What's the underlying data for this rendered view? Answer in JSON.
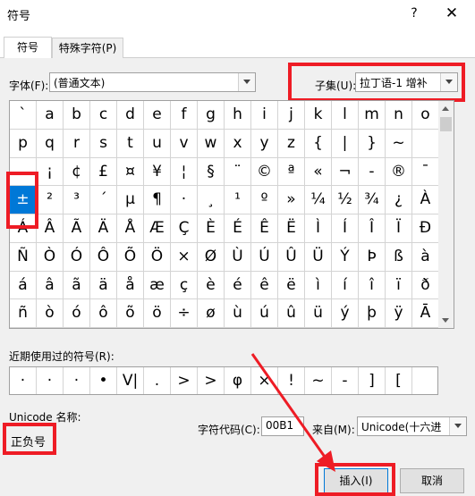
{
  "window": {
    "title": "符号",
    "help": "?",
    "close": "✕"
  },
  "tabs": [
    {
      "label": "符号"
    },
    {
      "label": "特殊字符(P)"
    }
  ],
  "font": {
    "label": "字体(F):",
    "value": "(普通文本)"
  },
  "subset": {
    "label": "子集(U):",
    "value": "拉丁语-1 增补"
  },
  "grid": {
    "rows": [
      [
        "`",
        "a",
        "b",
        "c",
        "d",
        "e",
        "f",
        "g",
        "h",
        "i",
        "j",
        "k",
        "l",
        "m",
        "n",
        "o"
      ],
      [
        "p",
        "q",
        "r",
        "s",
        "t",
        "u",
        "v",
        "w",
        "x",
        "y",
        "z",
        "{",
        "|",
        "}",
        "~",
        ""
      ],
      [
        "",
        "¡",
        "¢",
        "£",
        "¤",
        "¥",
        "¦",
        "§",
        "¨",
        "©",
        "ª",
        "«",
        "¬",
        "-",
        "®",
        "¯"
      ],
      [
        "°",
        "±",
        "²",
        "³",
        "´",
        "µ",
        "¶",
        "·",
        "¸",
        "¹",
        "º",
        "»",
        "¼",
        "½",
        "¾",
        "¿"
      ],
      [
        "À",
        "Á",
        "Â",
        "Ã",
        "Ä",
        "Å",
        "Æ",
        "Ç",
        "È",
        "É",
        "Ê",
        "Ë",
        "Ì",
        "Í",
        "Î",
        "Ï"
      ],
      [
        "Ð",
        "Ñ",
        "Ò",
        "Ó",
        "Ô",
        "Õ",
        "Ö",
        "×",
        "Ø",
        "Ù",
        "Ú",
        "Û",
        "Ü",
        "Ý",
        "Þ",
        "ß"
      ],
      [
        "à",
        "á",
        "â",
        "ã",
        "ä",
        "å",
        "æ",
        "ç",
        "è",
        "é",
        "ê",
        "ë",
        "ì",
        "í",
        "î",
        "ï"
      ],
      [
        "ð",
        "ñ",
        "ò",
        "ó",
        "ô",
        "õ",
        "ö",
        "÷",
        "ø",
        "ù",
        "ú",
        "û",
        "ü",
        "ý",
        "þ",
        "ÿ"
      ]
    ],
    "display": [
      [
        "`",
        "a",
        "b",
        "c",
        "d",
        "e",
        "f",
        "g",
        "h",
        "i",
        "j",
        "k",
        "l",
        "m",
        "n",
        "o"
      ],
      [
        "p",
        "q",
        "r",
        "s",
        "t",
        "u",
        "v",
        "w",
        "x",
        "y",
        "z",
        "{",
        "|",
        "}",
        "~",
        ""
      ],
      [
        "",
        "¡",
        "¢",
        "£",
        "¤",
        "¥",
        "¦",
        "§",
        "¨",
        "©",
        "ª",
        "«",
        "¬",
        "-",
        "®",
        "¯"
      ],
      [
        "±",
        "²",
        "³",
        "´",
        "µ",
        "¶",
        "·",
        "¸",
        "¹",
        "º",
        "»",
        "¼",
        "½",
        "¾",
        "¿",
        "À"
      ],
      [
        "Á",
        "Â",
        "Ã",
        "Ä",
        "Å",
        "Æ",
        "Ç",
        "È",
        "É",
        "Ê",
        "Ë",
        "Ì",
        "Í",
        "Î",
        "Ï",
        "Ð"
      ],
      [
        "Ñ",
        "Ò",
        "Ó",
        "Ô",
        "Õ",
        "Ö",
        "×",
        "Ø",
        "Ù",
        "Ú",
        "Û",
        "Ü",
        "Ý",
        "Þ",
        "ß",
        "à"
      ],
      [
        "á",
        "â",
        "ã",
        "ä",
        "å",
        "æ",
        "ç",
        "è",
        "é",
        "ê",
        "ë",
        "ì",
        "í",
        "î",
        "ï",
        "ð"
      ],
      [
        "ñ",
        "ò",
        "ó",
        "ô",
        "õ",
        "ö",
        "÷",
        "ø",
        "ù",
        "ú",
        "û",
        "ü",
        "ý",
        "þ",
        "ÿ",
        "Ā"
      ]
    ],
    "selected": "±"
  },
  "recent": {
    "label": "近期使用过的符号(R):",
    "symbols": [
      "·",
      "·",
      "·",
      "•",
      "V|",
      ".",
      ">",
      ">",
      "φ",
      "×",
      "!",
      "~",
      "-",
      "]",
      "["
    ]
  },
  "unicode_name": {
    "label": "Unicode 名称:",
    "value": "正负号"
  },
  "char_code": {
    "label": "字符代码(C):",
    "value": "00B1"
  },
  "from": {
    "label": "来自(M):",
    "value": "Unicode(十六进"
  },
  "buttons": {
    "insert": "插入(I)",
    "cancel": "取消"
  },
  "colors": {
    "accent": "#0078d7",
    "highlight": "#ee1c25"
  }
}
